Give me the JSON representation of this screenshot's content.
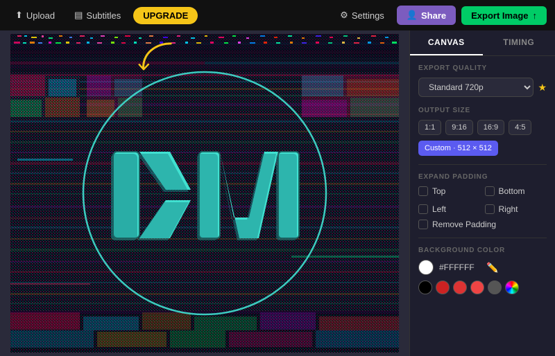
{
  "topbar": {
    "upload_label": "Upload",
    "subtitles_label": "Subtitles",
    "upgrade_label": "UPGRADE",
    "settings_label": "Settings",
    "share_label": "Share",
    "export_label": "Export Image"
  },
  "panel": {
    "canvas_tab": "CANVAS",
    "timing_tab": "TIMING",
    "export_quality_label": "EXPORT QUALITY",
    "quality_value": "Standard 720p",
    "output_size_label": "OUTPUT SIZE",
    "sizes": [
      "1:1",
      "9:16",
      "16:9",
      "4:5"
    ],
    "active_size": "Custom · 512 × 512",
    "expand_padding_label": "EXPAND PADDING",
    "top_label": "Top",
    "bottom_label": "Bottom",
    "left_label": "Left",
    "right_label": "Right",
    "remove_padding_label": "Remove Padding",
    "bg_color_label": "BACKGROUND COLOR",
    "hex_value": "#FFFFFF",
    "swatches": [
      "#000000",
      "#cc2222",
      "#dd3333",
      "#ee4444",
      "#555555",
      "#777777"
    ]
  },
  "canvas": {
    "annotation_arrow": "↩"
  }
}
